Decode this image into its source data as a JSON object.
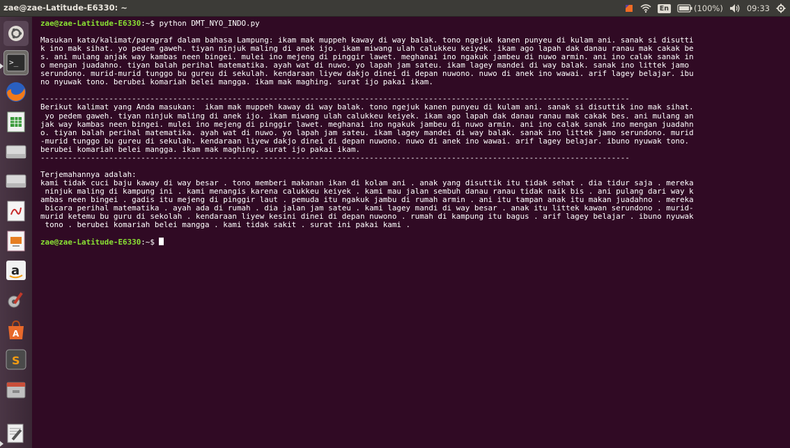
{
  "topbar": {
    "title": "zae@zae-Latitude-E6330: ~",
    "keyboard_layout": "En",
    "battery": "(100%)",
    "time": "09:33",
    "icons": [
      "dropbox-icon",
      "wifi-icon",
      "keyboard-icon",
      "battery-icon",
      "volume-icon",
      "power-gear-icon"
    ]
  },
  "launcher": {
    "items": [
      "ubuntu-dash-icon",
      "terminal-icon",
      "firefox-icon",
      "spreadsheet-icon",
      "drive-icon",
      "drive-icon",
      "pdf-viewer-icon",
      "presentation-icon",
      "amazon-icon",
      "settings-icon",
      "software-center-icon",
      "sublime-icon",
      "file-manager-icon",
      "text-editor-icon"
    ]
  },
  "terminal": {
    "prompt_user": "zae@zae-Latitude-E6330",
    "prompt_path": ":~$",
    "command": " python DMT_NYO_INDO.py",
    "lines": [
      "",
      "Masukan kata/kalimat/paragraf dalam bahasa Lampung: ikam mak muppeh kaway di way balak. tono ngejuk kanen punyeu di kulam ani. sanak si disutti",
      "k ino mak sihat. yo pedem gaweh. tiyan ninjuk maling di anek ijo. ikam miwang ulah calukkeu keiyek. ikam ago lapah dak danau ranau mak cakak be",
      "s. ani mulang anjak way kambas neen bingei. mulei ino mejeng di pinggir lawet. meghanai ino ngakuk jambeu di nuwo armin. ani ino calak sanak in",
      "o mengan juadahno. tiyan balah perihal matematika. ayah wat di nuwo. yo lapah jam sateu. ikam lagey mandei di way balak. sanak ino littek jamo",
      "serundono. murid-murid tunggo bu gureu di sekulah. kendaraan liyew dakjo dinei di depan nuwono. nuwo di anek ino wawai. arif lagey belajar. ibu",
      "no nyuwak tono. berubei komariah belei mangga. ikam mak maghing. surat ijo pakai ikam.",
      "",
      "---------------------------------------------------------------------------------------------------------------------------------",
      "Berikut kalimat yang Anda masukan:  ikam mak muppeh kaway di way balak. tono ngejuk kanen punyeu di kulam ani. sanak si disuttik ino mak sihat.",
      " yo pedem gaweh. tiyan ninjuk maling di anek ijo. ikam miwang ulah calukkeu keiyek. ikam ago lapah dak danau ranau mak cakak bes. ani mulang an",
      "jak way kambas neen bingei. mulei ino mejeng di pinggir lawet. meghanai ino ngakuk jambeu di nuwo armin. ani ino calak sanak ino mengan juadahn",
      "o. tiyan balah perihal matematika. ayah wat di nuwo. yo lapah jam sateu. ikam lagey mandei di way balak. sanak ino littek jamo serundono. murid",
      "-murid tunggo bu gureu di sekulah. kendaraan liyew dakjo dinei di depan nuwono. nuwo di anek ino wawai. arif lagey belajar. ibuno nyuwak tono.",
      "berubei komariah belei mangga. ikam mak maghing. surat ijo pakai ikam.",
      "---------------------------------------------------------------------------------------------------------------------------------",
      "",
      "Terjemahannya adalah:",
      "kami tidak cuci baju kaway di way besar . tono memberi makanan ikan di kolam ani . anak yang disuttik itu tidak sehat . dia tidur saja . mereka",
      " ninjuk maling di kampung ini . kami menangis karena calukkeu keiyek . kami mau jalan sembuh danau ranau tidak naik bis . ani pulang dari way k",
      "ambas neen bingei . gadis itu mejeng di pinggir laut . pemuda itu ngakuk jambu di rumah armin . ani itu tampan anak itu makan juadahno . mereka",
      " bicara perihal matematika . ayah ada di rumah . dia jalan jam sateu . kami lagey mandi di way besar . anak itu littek kawan serundono . murid-",
      "murid ketemu bu guru di sekolah . kendaraan liyew kesini dinei di depan nuwono . rumah di kampung itu bagus . arif lagey belajar . ibuno nyuwak",
      " tono . berubei komariah belei mangga . kami tidak sakit . surat ini pakai kami .",
      ""
    ],
    "final_prompt_user": "zae@zae-Latitude-E6330",
    "final_prompt_path": ":~$"
  }
}
